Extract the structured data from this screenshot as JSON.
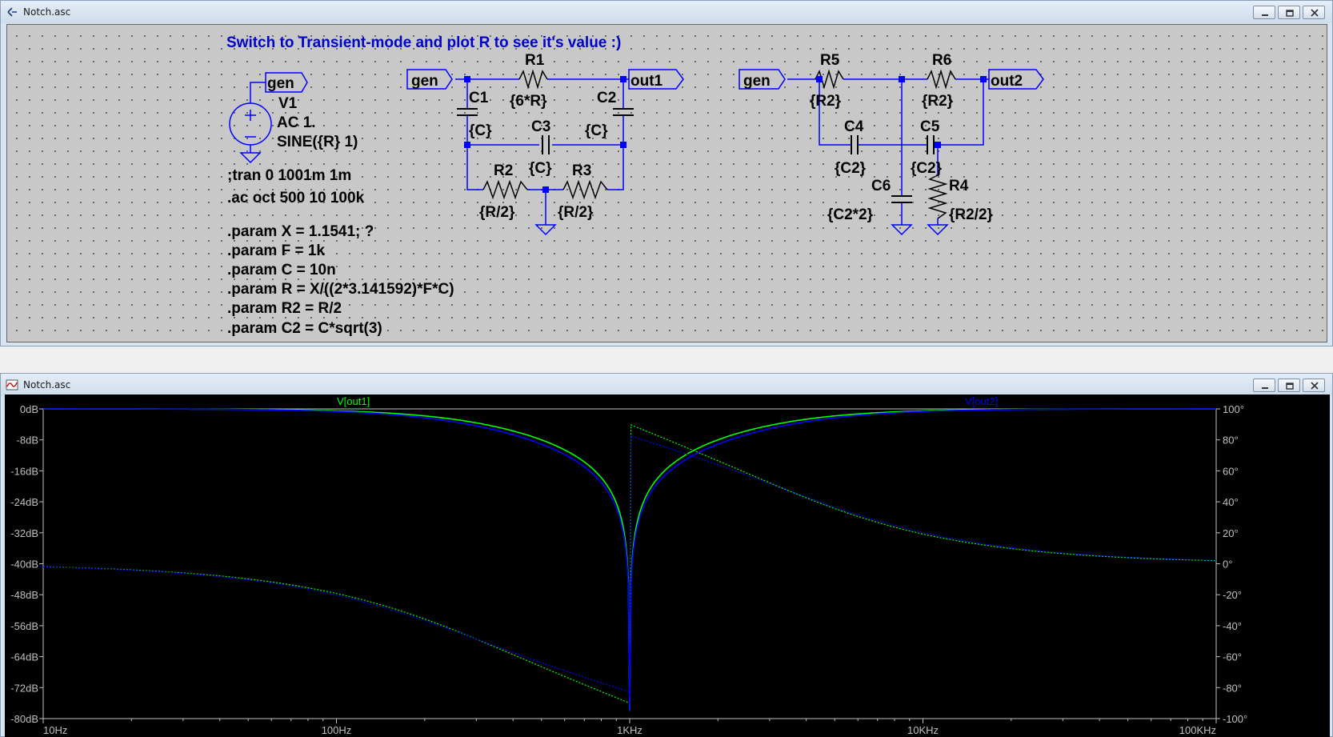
{
  "colors": {
    "wire": "#0000ff",
    "text": "#000000",
    "note": "#0000cc",
    "trace1": "#00ff00",
    "trace2": "#0000ff",
    "axis": "#bfbfbf"
  },
  "schematic_window": {
    "title": "Notch.asc",
    "icon": "ltspice-schematic-icon",
    "controls": [
      "minimize-icon",
      "restore-icon",
      "close-icon"
    ],
    "comment": "Switch to Transient-mode and plot R to see it's value :)",
    "source": {
      "name": "V1",
      "ac": "AC 1.",
      "value": "SINE({R} 1)"
    },
    "net_labels": {
      "gen": "gen",
      "out1": "out1",
      "out2": "out2"
    },
    "directives": [
      ";tran 0 1001m 1m",
      ".ac oct 500 10 100k"
    ],
    "params": [
      ".param X = 1.1541; ?",
      ".param F = 1k",
      ".param C = 10n",
      ".param R = X/((2*3.141592)*F*C)",
      ".param R2 = R/2",
      ".param C2 = C*sqrt(3)"
    ],
    "components": {
      "R1": {
        "name": "R1",
        "value": "{6*R}"
      },
      "C1": {
        "name": "C1",
        "value": "{C}"
      },
      "C2": {
        "name": "C2",
        "value": "{C}"
      },
      "C3": {
        "name": "C3",
        "value": "{C}"
      },
      "R2": {
        "name": "R2",
        "value": "{R/2}"
      },
      "R3": {
        "name": "R3",
        "value": "{R/2}"
      },
      "R5": {
        "name": "R5",
        "value": "{R2}"
      },
      "R6": {
        "name": "R6",
        "value": "{R2}"
      },
      "C4": {
        "name": "C4",
        "value": "{C2}"
      },
      "C5": {
        "name": "C5",
        "value": "{C2}"
      },
      "C6": {
        "name": "C6",
        "value": "{C2*2}"
      },
      "R4": {
        "name": "R4",
        "value": "{R2/2}"
      }
    }
  },
  "plot_window": {
    "title": "Notch.asc",
    "icon": "waveform-icon",
    "controls": [
      "minimize-icon",
      "restore-icon",
      "close-icon"
    ]
  },
  "chart_data": {
    "type": "line",
    "x_scale": "log",
    "xlim": [
      10,
      100000
    ],
    "x_ticks": [
      "10Hz",
      "100Hz",
      "1KHz",
      "10KHz",
      "100KHz"
    ],
    "y_left_label_ticks": [
      "0dB",
      "-8dB",
      "-16dB",
      "-24dB",
      "-32dB",
      "-40dB",
      "-48dB",
      "-56dB",
      "-64dB",
      "-72dB",
      "-80dB"
    ],
    "y_right_label_ticks": [
      "100°",
      "80°",
      "60°",
      "40°",
      "20°",
      "0°",
      "-20°",
      "-40°",
      "-60°",
      "-80°",
      "-100°"
    ],
    "ylim_left": [
      -80,
      0
    ],
    "ylim_right": [
      -100,
      100
    ],
    "grid": false,
    "notch_freq": 1000,
    "series": [
      {
        "name": "V[out1]",
        "color": "#00ff00",
        "Q": 0.29,
        "phase_scale": 1.0
      },
      {
        "name": "V[out2]",
        "color": "#0000ff",
        "Q": 0.25,
        "phase_scale": 0.92
      }
    ]
  }
}
